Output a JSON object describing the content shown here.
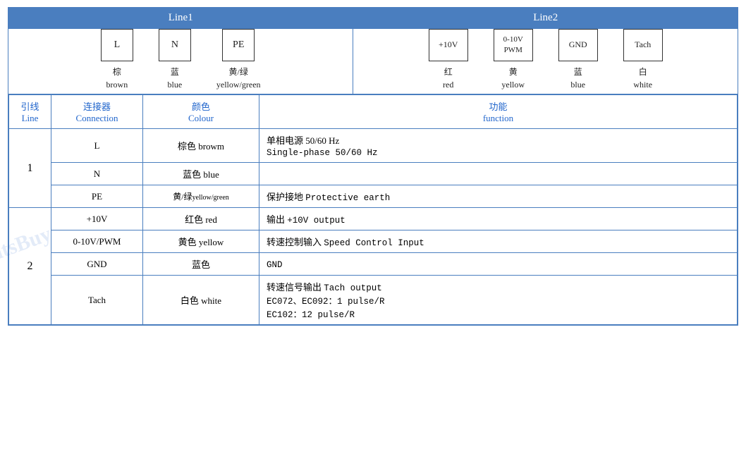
{
  "header": {
    "line1_label": "Line1",
    "line2_label": "Line2"
  },
  "line1_connectors": [
    {
      "symbol": "L",
      "color_zh": "棕",
      "color_en": "brown"
    },
    {
      "symbol": "N",
      "color_zh": "蓝",
      "color_en": "blue"
    },
    {
      "symbol": "PE",
      "color_zh": "黄/绿",
      "color_en": "yellow/green"
    }
  ],
  "line2_connectors": [
    {
      "symbol": "+10V",
      "color_zh": "红",
      "color_en": "red"
    },
    {
      "symbol": "0-10V\nPWM",
      "color_zh": "黄",
      "color_en": "yellow"
    },
    {
      "symbol": "GND",
      "color_zh": "蓝",
      "color_en": "blue"
    },
    {
      "symbol": "Tach",
      "color_zh": "白",
      "color_en": "white"
    }
  ],
  "table_headers": {
    "line_zh": "引线",
    "line_en": "Line",
    "connection_zh": "连接器",
    "connection_en": "Connection",
    "colour_zh": "颜色",
    "colour_en": "Colour",
    "function_zh": "功能",
    "function_en": "function"
  },
  "rows": [
    {
      "line": "1",
      "entries": [
        {
          "connection": "L",
          "color": "棕色 browm",
          "function": "单相电源 50/60 Hz\nSingle-phase 50/60 Hz"
        },
        {
          "connection": "N",
          "color": "蓝色 blue",
          "function": ""
        },
        {
          "connection": "PE",
          "color": "黄/绿yellow/green",
          "function": "保护接地 Protective earth"
        }
      ]
    },
    {
      "line": "2",
      "entries": [
        {
          "connection": "+10V",
          "color": "红色 red",
          "function": "输出 +10V output"
        },
        {
          "connection": "0-10V/PWM",
          "color": "黄色 yellow",
          "function": "转速控制输入 Speed Control Input"
        },
        {
          "connection": "GND",
          "color": "蓝色",
          "function": "GND"
        },
        {
          "connection": "Tach",
          "color": "白色 white",
          "function": "转速信号输出 Tach output\nEC072、EC092：1 pulse/R\nEC102：12 pulse/R"
        }
      ]
    }
  ]
}
